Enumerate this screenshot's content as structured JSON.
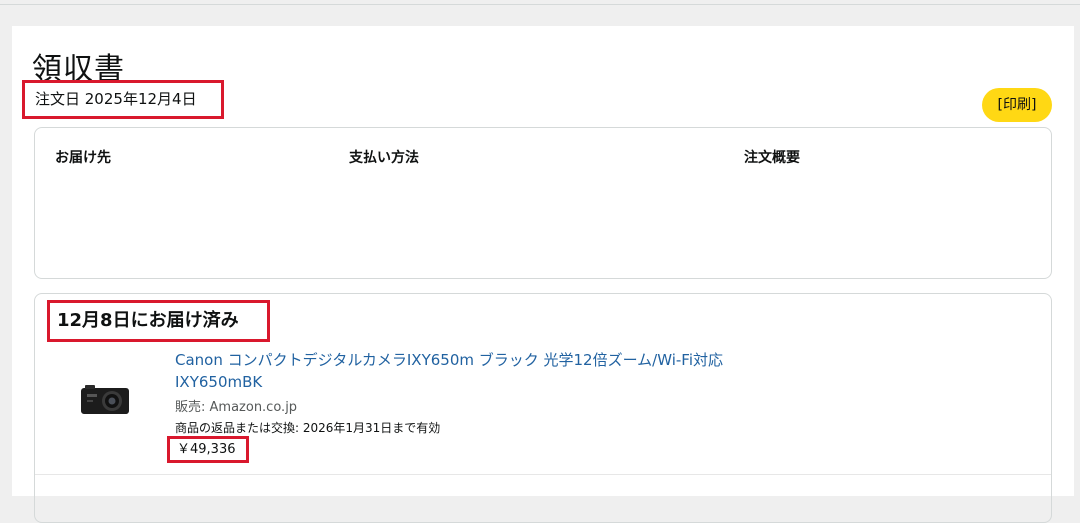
{
  "receipt": {
    "title": "領収書",
    "order_date": "注文日 2025年12月4日",
    "print_label": "[印刷]"
  },
  "summary": {
    "ship_to_label": "お届け先",
    "payment_label": "支払い方法",
    "order_summary_label": "注文概要"
  },
  "shipment": {
    "status": "12月8日にお届け済み",
    "item": {
      "title": "Canon コンパクトデジタルカメラIXY650m ブラック 光学12倍ズーム/Wi-Fi対応 IXY650mBK",
      "seller": "販売: Amazon.co.jp",
      "return_note": "商品の返品または交換: 2026年1月31日まで有効",
      "price": "￥49,336",
      "thumbnail_icon": "camera-icon"
    }
  },
  "colors": {
    "highlight_border": "#d9182d",
    "print_button": "#ffd814",
    "link": "#2162a1"
  }
}
